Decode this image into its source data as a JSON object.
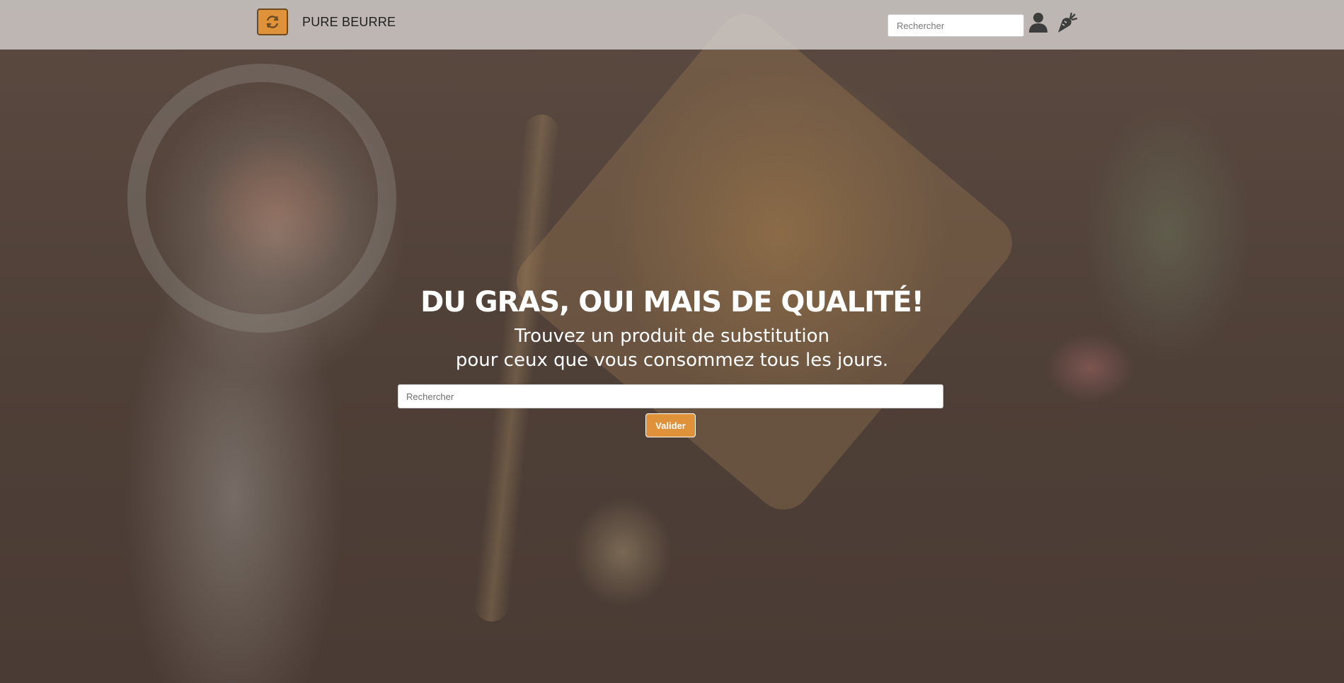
{
  "header": {
    "brand_name": "PURE BEURRE",
    "search_placeholder": "Rechercher",
    "search_value": "",
    "logo_icon": "recycle-arrows-icon",
    "user_icon": "user-icon",
    "carrot_icon": "carrot-icon"
  },
  "hero": {
    "title": "DU GRAS, OUI MAIS DE QUALITÉ!",
    "subtitle_line1": "Trouvez un produit de substitution",
    "subtitle_line2": "pour ceux que vous consommez tous les jours.",
    "search_placeholder": "Rechercher",
    "search_value": "",
    "submit_label": "Valider"
  },
  "colors": {
    "accent": "#e0923a",
    "navbar_bg": "#d6d2d0",
    "hero_text": "#ffffff",
    "background": "#4f4039"
  }
}
